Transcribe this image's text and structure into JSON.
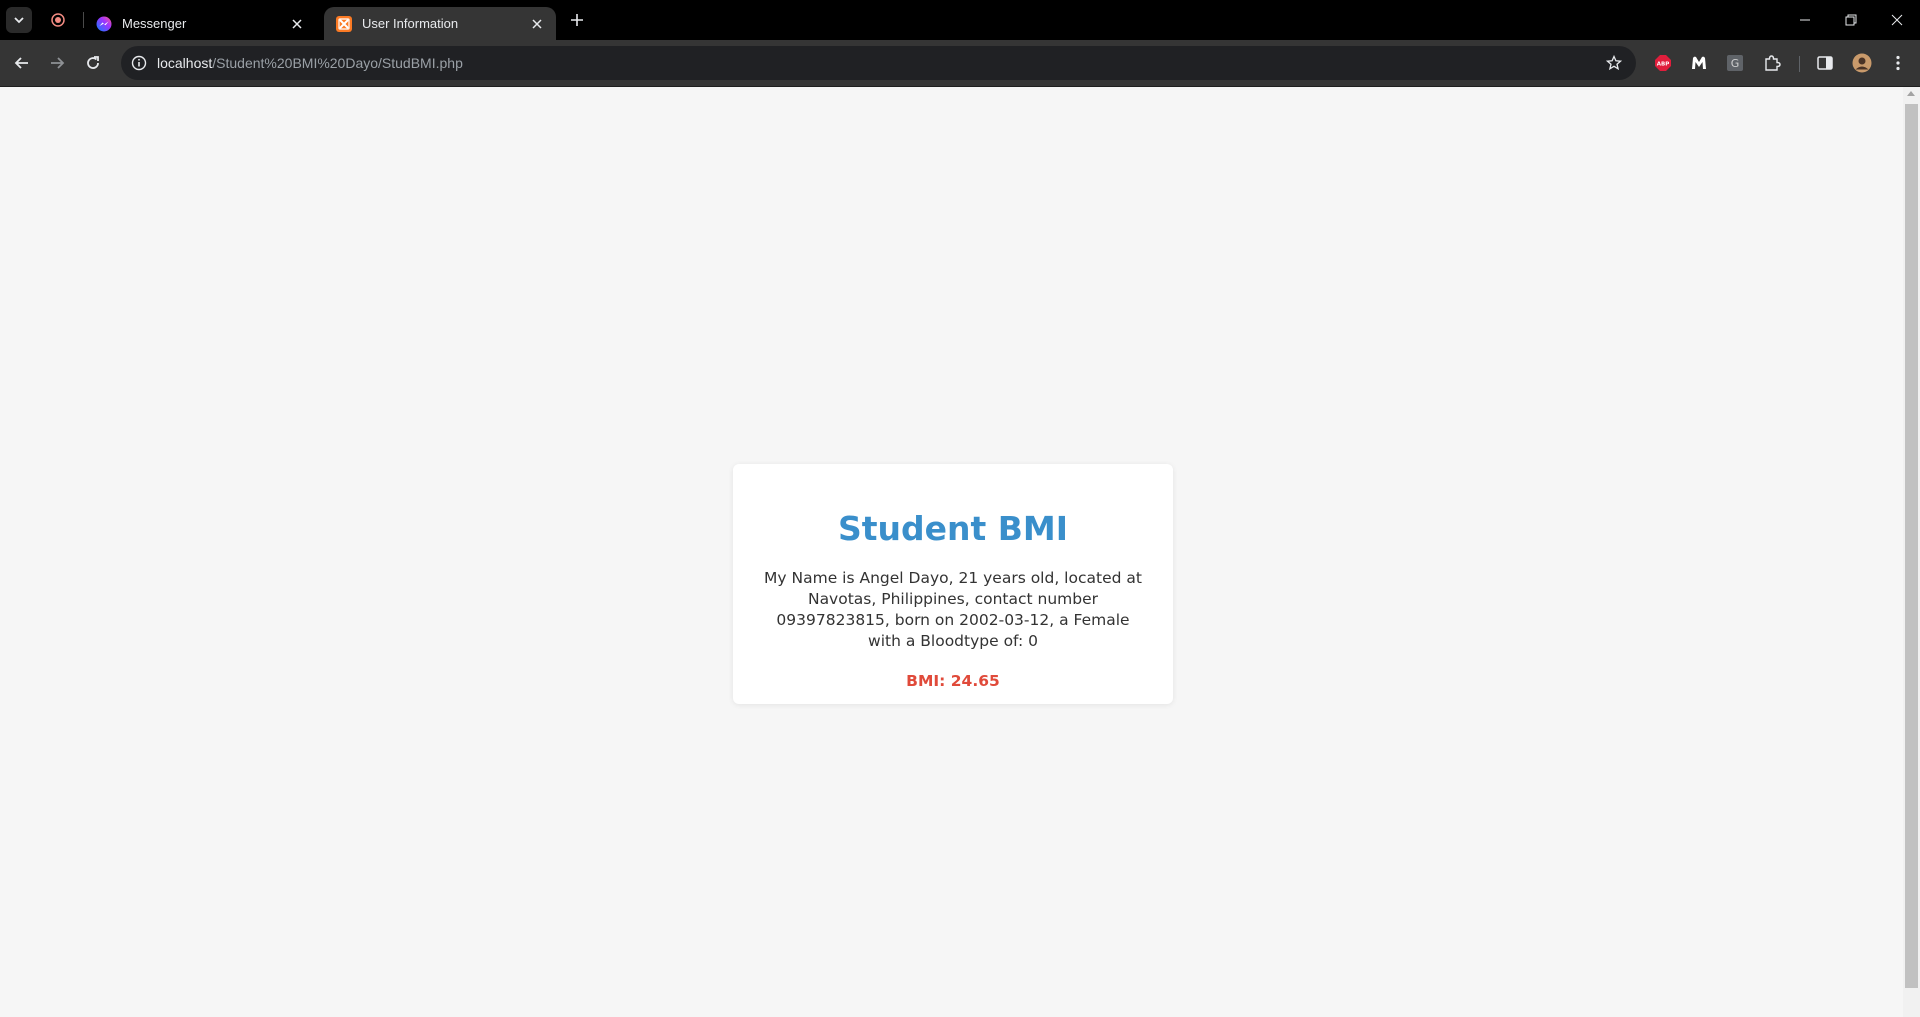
{
  "browser": {
    "tabs": [
      {
        "title": "Messenger",
        "active": false,
        "icon": "messenger-icon"
      },
      {
        "title": "User Information",
        "active": true,
        "icon": "xampp-icon"
      }
    ],
    "address": {
      "host": "localhost",
      "path": "/Student%20BMI%20Dayo/StudBMI.php"
    },
    "extensions": [
      "adblock-plus-icon",
      "malwarebytes-icon",
      "g-extension-icon",
      "puzzle-icon"
    ]
  },
  "page": {
    "title": "Student BMI",
    "description": "My Name is Angel Dayo, 21 years old, located at Navotas, Philippines, contact number 09397823815, born on 2002-03-12, a Female with a Bloodtype of: 0",
    "bmi": "BMI: 24.65"
  },
  "colors": {
    "heading": "#3a8fcb",
    "bmi": "#e04a3a",
    "page_bg": "#f6f6f6",
    "chrome_dark": "#000000",
    "toolbar": "#353535"
  }
}
